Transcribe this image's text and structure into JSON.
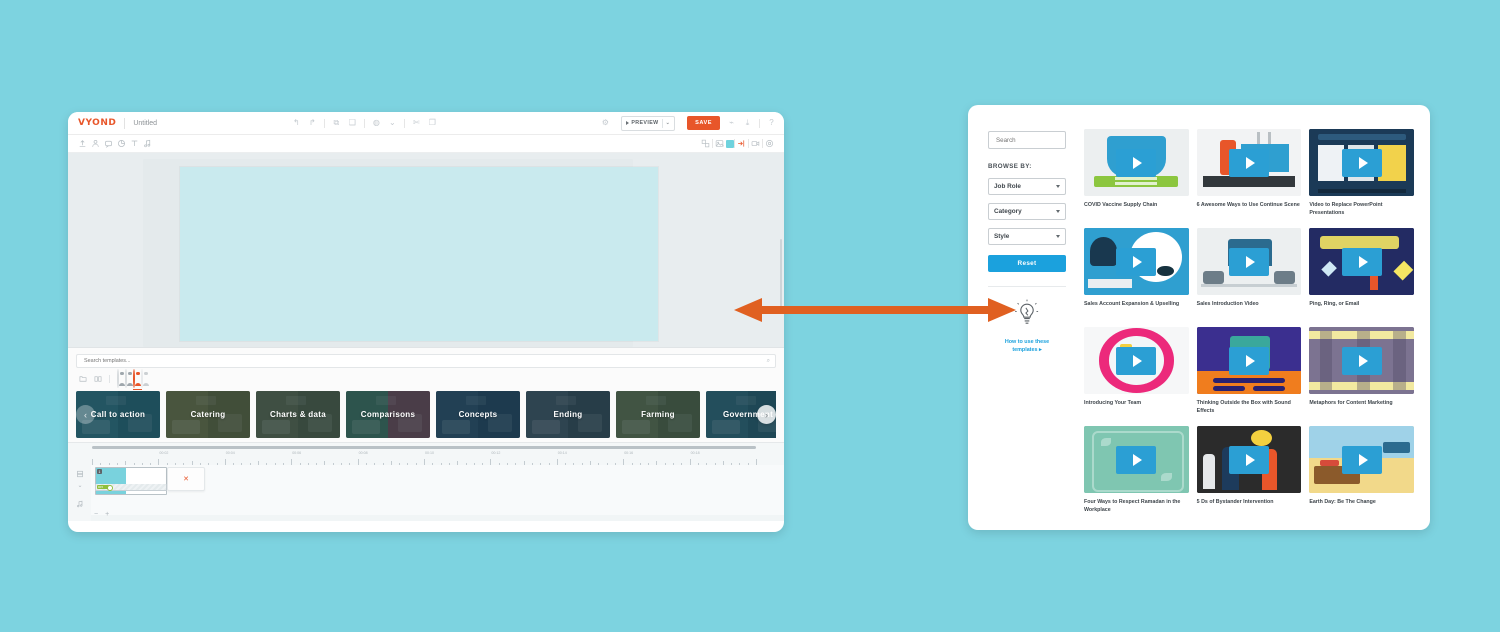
{
  "background_color": "#7dd3e0",
  "accent_orange": "#e8562a",
  "accent_blue": "#1ba1dd",
  "editor": {
    "brand": "VYOND",
    "document_title": "Untitled",
    "app_bar": {
      "undo_icon": "undo-icon",
      "redo_icon": "redo-icon",
      "copy_icon": "copy-icon",
      "paste_icon": "paste-icon",
      "theme_icon": "theme-icon",
      "theme_caret_icon": "chevron-down-icon",
      "cut_icon": "scissors-icon",
      "duplicate_icon": "duplicate-icon",
      "settings_icon": "gear-icon",
      "preview_label": "PREVIEW",
      "preview_caret_icon": "chevron-down-icon",
      "save_label": "SAVE",
      "share_icon": "share-icon",
      "download_icon": "download-icon",
      "help_icon": "help-icon"
    },
    "toolbar": {
      "left_icons": [
        {
          "name": "upload-icon",
          "title": "Upload"
        },
        {
          "name": "character-icon",
          "title": "Characters"
        },
        {
          "name": "prop-icon",
          "title": "Props"
        },
        {
          "name": "chart-icon",
          "title": "Charts"
        },
        {
          "name": "text-icon",
          "title": "Text"
        },
        {
          "name": "audio-icon",
          "title": "Audio"
        }
      ],
      "right_icons": [
        {
          "name": "layers-icon",
          "title": "Layers"
        },
        {
          "name": "background-icon",
          "title": "Background"
        },
        {
          "name": "color-swatch",
          "title": "Color",
          "color": "#6fd2dd"
        },
        {
          "name": "enter-exit-icon",
          "title": "Enter/Exit"
        },
        {
          "name": "camera-icon",
          "title": "Camera"
        },
        {
          "name": "scene-settings-icon",
          "title": "Scene Settings"
        }
      ]
    },
    "templates": {
      "search_placeholder": "Search templates...",
      "search_value": "",
      "search_icon": "search-icon",
      "tabs": [
        {
          "name": "folder-icon"
        },
        {
          "name": "slides-icon"
        }
      ],
      "avatars": [
        {
          "name": "style-contemporary",
          "selected": false
        },
        {
          "name": "style-business-friendly",
          "selected": false
        },
        {
          "name": "style-whiteboard",
          "selected": true
        },
        {
          "name": "style-more",
          "selected": false
        }
      ],
      "prev_icon": "chevron-left-icon",
      "next_icon": "chevron-right-icon",
      "cards": [
        {
          "label": "Call to action",
          "color1": "#2c6b7a",
          "color2": "#245f6e"
        },
        {
          "label": "Catering",
          "color1": "#6a6b3f",
          "color2": "#5d5f37"
        },
        {
          "label": "Charts & data",
          "color1": "#5a6248",
          "color2": "#4e5840"
        },
        {
          "label": "Comparisons",
          "color1": "#3d6a58",
          "color2": "#6b4550"
        },
        {
          "label": "Concepts",
          "color1": "#2a4a63",
          "color2": "#22405a"
        },
        {
          "label": "Ending",
          "color1": "#3e4f5c",
          "color2": "#334450"
        },
        {
          "label": "Farming",
          "color1": "#5c6a48",
          "color2": "#4f5d3e"
        },
        {
          "label": "Government",
          "color1": "#2c5f70",
          "color2": "#255565"
        }
      ]
    },
    "timeline": {
      "ruler_labels": [
        "00:02",
        "00:04",
        "00:06",
        "00:08",
        "00:10",
        "00:12",
        "00:14",
        "00:16",
        "00:18"
      ],
      "scene_number": "1",
      "track_icons": [
        {
          "name": "scene-track-icon"
        },
        {
          "name": "chevron-down-icon"
        },
        {
          "name": "audio-track-icon"
        }
      ],
      "clip_menu_icon": "close-scene-icon",
      "audio_chip_label": "MP3",
      "zoom_out_label": "−",
      "zoom_in_label": "+"
    }
  },
  "library": {
    "search_placeholder": "Search",
    "search_value": "",
    "search_icon": "search-icon",
    "browse_by_label": "BROWSE BY:",
    "filters": [
      {
        "name": "job-role",
        "label": "Job Role"
      },
      {
        "name": "category",
        "label": "Category"
      },
      {
        "name": "style",
        "label": "Style"
      }
    ],
    "reset_label": "Reset",
    "bulb_icon": "lightbulb-icon",
    "help_link_line1": "How to use these",
    "help_link_line2": "templates ▸",
    "videos": [
      {
        "title": "COVID Vaccine Supply Chain",
        "bg": "#eceff0",
        "art": "covid-supply-chain",
        "colors": [
          "#2f9fd0",
          "#8cc63f",
          "#f5f6f6"
        ]
      },
      {
        "title": "6 Awesome Ways to Use Continue Scene",
        "bg": "#f0f1f2",
        "art": "kitchen-six",
        "colors": [
          "#e8562a",
          "#2f2f2f",
          "#ffffff"
        ]
      },
      {
        "title": "Video to Replace PowerPoint Presentations",
        "bg": "#1b3a57",
        "art": "subscription-plans",
        "colors": [
          "#1b3a57",
          "#f2d24b",
          "#eef2f5"
        ]
      },
      {
        "title": "Sales Account Expansion & Upselling",
        "bg": "#2f9fd0",
        "art": "sales-account",
        "colors": [
          "#2f9fd0",
          "#ffffff",
          "#19384f"
        ]
      },
      {
        "title": "Sales Introduction Video",
        "bg": "#eceff0",
        "art": "sales-intro",
        "colors": [
          "#eceff0",
          "#2b6b8f",
          "#c7ced2"
        ]
      },
      {
        "title": "Ping, Ring, or Email",
        "bg": "#232b63",
        "art": "ping-ring-email",
        "colors": [
          "#232b63",
          "#f5e663",
          "#e8562a"
        ]
      },
      {
        "title": "Introducing Your Team",
        "bg": "#f6f7f8",
        "art": "introducing-team",
        "colors": [
          "#ec297b",
          "#f4d03f",
          "#2f9fd0"
        ]
      },
      {
        "title": "Thinking Outside the Box with Sound Effects",
        "bg": "#3b2f8f",
        "art": "thinking-box",
        "colors": [
          "#3b2f8f",
          "#f07d1e",
          "#3aa89c"
        ]
      },
      {
        "title": "Metaphors for Content Marketing",
        "bg": "#7c7391",
        "art": "metaphors-content",
        "colors": [
          "#7c7391",
          "#f2e9a0",
          "#4c4560"
        ]
      },
      {
        "title": "Four Ways to Respect Ramadan in the Workplace",
        "bg": "#7fc6b1",
        "art": "ramadan-workplace",
        "colors": [
          "#7fc6b1",
          "#ffffff",
          "#4f9e88"
        ]
      },
      {
        "title": "5 Ds of Bystander Intervention",
        "bg": "#2b2b2b",
        "art": "bystander",
        "colors": [
          "#2b2b2b",
          "#e8562a",
          "#f4d03f"
        ]
      },
      {
        "title": "Earth Day: Be The Change",
        "bg": "#f2d98a",
        "art": "earth-day",
        "colors": [
          "#9fd2e8",
          "#f2d98a",
          "#8b5a2b"
        ]
      }
    ]
  },
  "annotation": {
    "arrow_name": "double-headed-arrow",
    "arrow_color": "#e06021"
  }
}
